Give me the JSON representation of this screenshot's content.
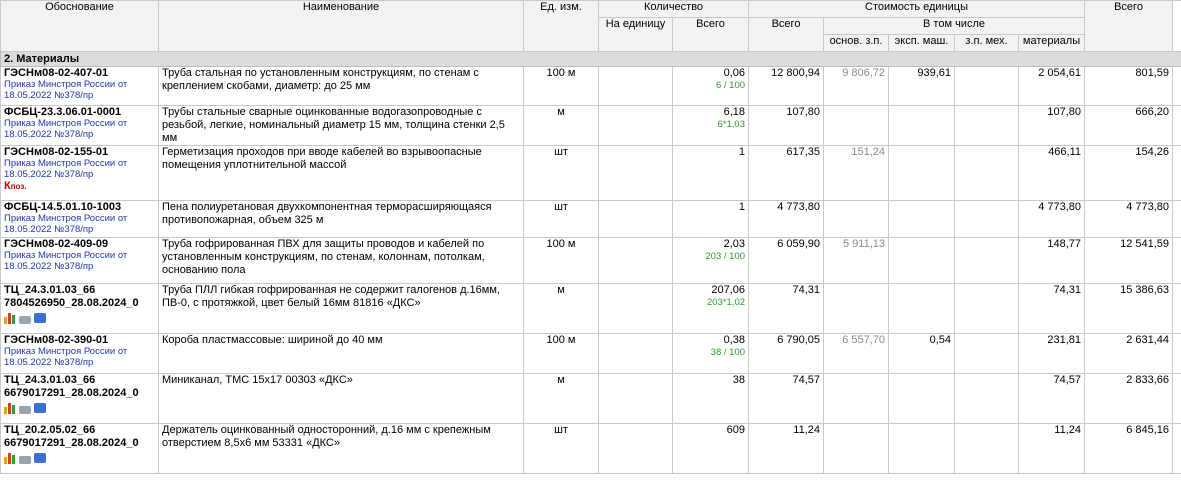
{
  "headers": {
    "basis": "Обоснование",
    "name": "Наименование",
    "unit": "Ед. изм.",
    "quantity": "Количество",
    "qty_per_unit": "На единицу",
    "qty_total": "Всего",
    "unit_cost": "Стоимость единицы",
    "uc_total": "Всего",
    "incl": "В том числе",
    "base_wage": "основ. з.п.",
    "machine": "эксп. маш.",
    "machine_wage": "з.п. мех.",
    "materials": "материалы",
    "grand_total": "Всего"
  },
  "section": "2. Материалы",
  "rows": [
    {
      "code": "ГЭСНм08-02-407-01",
      "order": "Приказ Минстроя России от 18.05.2022 №378/пр",
      "name": "Труба стальная по установленным конструкциям, по стенам с креплением скобами, диаметр: до 25 мм",
      "unit": "100 м",
      "qty": "0,06",
      "qty_note": "6 / 100",
      "total": "12 800,94",
      "wage": "9 806,72",
      "mach": "939,61",
      "mwage": "",
      "mat": "2 054,61",
      "grand": "801,59"
    },
    {
      "code": "ФСБЦ-23.3.06.01-0001",
      "order": "Приказ Минстроя России от 18.05.2022 №378/пр",
      "name": "Трубы стальные сварные оцинкованные водогазопроводные с резьбой, легкие, номинальный диаметр 15 мм, толщина стенки 2,5 мм",
      "unit": "м",
      "qty": "6,18",
      "qty_note": "6*1,03",
      "total": "107,80",
      "wage": "",
      "mach": "",
      "mwage": "",
      "mat": "107,80",
      "grand": "666,20"
    },
    {
      "code": "ГЭСНм08-02-155-01",
      "order": "Приказ Минстроя России от 18.05.2022 №378/пр",
      "name": "Герметизация проходов при вводе кабелей во взрывоопасные помещения уплотнительной массой",
      "unit": "шт",
      "qty": "1",
      "qty_note": "",
      "total": "617,35",
      "wage": "151,24",
      "mach": "",
      "mwage": "",
      "mat": "466,11",
      "grand": "154,26",
      "kpoz_k": "К",
      "kpoz_sub": "поз."
    },
    {
      "code": "ФСБЦ-14.5.01.10-1003",
      "order": "Приказ Минстроя России от 18.05.2022 №378/пр",
      "name": "Пена полиуретановая двухкомпонентная терморасширяющаяся противопожарная, объем 325 м",
      "unit": "шт",
      "qty": "1",
      "qty_note": "",
      "total": "4 773,80",
      "wage": "",
      "mach": "",
      "mwage": "",
      "mat": "4 773,80",
      "grand": "4 773,80"
    },
    {
      "code": "ГЭСНм08-02-409-09",
      "order": "Приказ Минстроя России от 18.05.2022 №378/пр",
      "name": "Труба гофрированная ПВХ для защиты проводов и кабелей по установленным конструкциям, по стенам, колоннам, потолкам, основанию пола",
      "unit": "100 м",
      "qty": "2,03",
      "qty_note": "203 / 100",
      "total": "6 059,90",
      "wage": "5 911,13",
      "mach": "",
      "mwage": "",
      "mat": "148,77",
      "grand": "12 541,59"
    },
    {
      "code": "ТЦ_24.3.01.03_66",
      "code2": "7804526950_28.08.2024_0",
      "order": "",
      "name": "Труба ПЛЛ гибкая гофрированная не содержит галогенов д.16мм, ПВ-0, с протяжкой, цвет белый 16мм 81816 «ДКС»",
      "unit": "м",
      "qty": "207,06",
      "qty_note": "203*1,02",
      "total": "74,31",
      "wage": "",
      "mach": "",
      "mwage": "",
      "mat": "74,31",
      "grand": "15 386,63",
      "icons": true
    },
    {
      "code": "ГЭСНм08-02-390-01",
      "order": "Приказ Минстроя России от 18.05.2022 №378/пр",
      "name": "Короба пластмассовые: шириной до 40 мм",
      "unit": "100 м",
      "qty": "0,38",
      "qty_note": "38 / 100",
      "total": "6 790,05",
      "wage": "6 557,70",
      "mach": "0,54",
      "mwage": "",
      "mat": "231,81",
      "grand": "2 631,44"
    },
    {
      "code": "ТЦ_24.3.01.03_66",
      "code2": "6679017291_28.08.2024_0",
      "order": "",
      "name": "Миниканал, ТМС 15x17 00303 «ДКС»",
      "unit": "м",
      "qty": "38",
      "qty_note": "",
      "total": "74,57",
      "wage": "",
      "mach": "",
      "mwage": "",
      "mat": "74,57",
      "grand": "2 833,66",
      "icons": true
    },
    {
      "code": "ТЦ_20.2.05.02_66",
      "code2": "6679017291_28.08.2024_0",
      "order": "",
      "name": "Держатель оцинкованный односторонний, д.16 мм с крепежным отверстием 8,5х6 мм 53331 «ДКС»",
      "unit": "шт",
      "qty": "609",
      "qty_note": "",
      "total": "11,24",
      "wage": "",
      "mach": "",
      "mwage": "",
      "mat": "11,24",
      "grand": "6 845,16",
      "icons": true
    }
  ],
  "icon_names": [
    "chart-icon",
    "printer-icon",
    "user-icon"
  ],
  "colors": {
    "order_link": "#2236b0",
    "note_green": "#2e9a2e",
    "kpoz_red": "#c00000",
    "section_bg": "#dcdcdc",
    "header_bg": "#f3f3f3"
  }
}
